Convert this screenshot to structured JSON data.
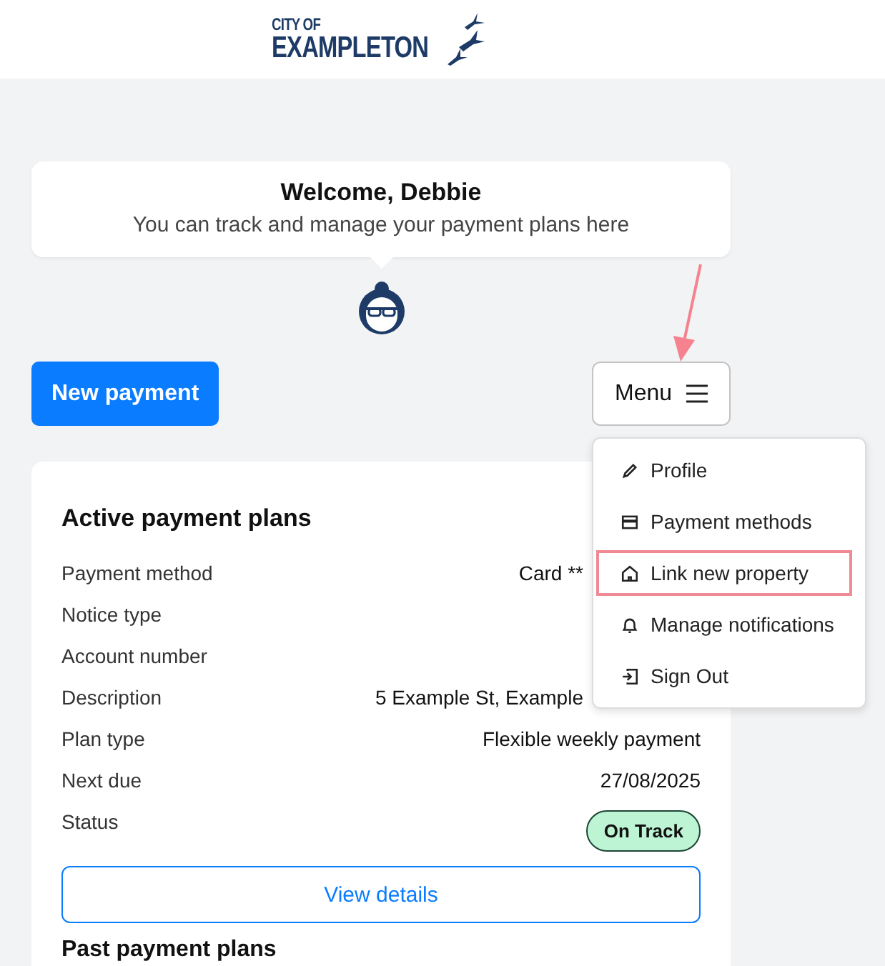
{
  "logo": {
    "line_1": "CITY OF",
    "line_2": "EXAMPLETON"
  },
  "welcome": {
    "title": "Welcome, Debbie",
    "subtitle": "You can track and manage your payment plans here"
  },
  "new_payment_button": "New payment",
  "menu_button": {
    "label": "Menu",
    "expanded": true
  },
  "menu_items": [
    {
      "label": "Profile",
      "kind": "pencil",
      "highlighted": false
    },
    {
      "label": "Payment methods",
      "kind": "card",
      "highlighted": false
    },
    {
      "label": "Link new property",
      "kind": "home",
      "highlighted": true
    },
    {
      "label": "Manage notifications",
      "kind": "bell",
      "highlighted": false
    },
    {
      "label": "Sign Out",
      "kind": "signout",
      "highlighted": false
    }
  ],
  "active_plans": {
    "title": "Active payment plans",
    "rows": [
      {
        "label": "Payment method",
        "value": "Card **"
      },
      {
        "label": "Notice type"
      },
      {
        "label": "Account number"
      },
      {
        "label": "Description",
        "value": "5 Example St, Example"
      },
      {
        "label": "Plan type",
        "value": "Flexible weekly payment"
      },
      {
        "label": "Next due",
        "value": "27/08/2025"
      },
      {
        "label": "Status",
        "badge": "On Track"
      }
    ],
    "view_details_button": "View details"
  },
  "past_plans": {
    "title": "Past payment plans"
  }
}
